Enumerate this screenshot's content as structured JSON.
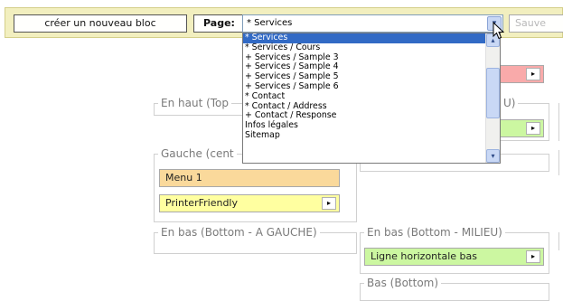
{
  "toolbar": {
    "new_block_label": "créer un nouveau bloc",
    "page_label": "Page:",
    "page_select_value": "* Services",
    "save_label": "Sauve"
  },
  "dropdown": {
    "items": [
      "* Services",
      "* Services / Cours",
      "+ Services / Sample 3",
      "+ Services / Sample 4",
      "+ Services / Sample 5",
      "+ Services / Sample 6",
      "* Contact",
      "* Contact / Address",
      "+ Contact / Response",
      "Infos légales",
      "Sitemap"
    ],
    "selected_index": 0
  },
  "zones": {
    "top_left_legend": "En haut (Top",
    "top_right_legend": "U)",
    "left_center_legend": "Gauche (cent",
    "bottom_left_legend": "En bas (Bottom - A GAUCHE)",
    "bottom_middle_legend": "En bas (Bottom - MILIEU)",
    "bottom_legend": "Bas (Bottom)"
  },
  "blocks": {
    "menu1": "Menu 1",
    "printer_friendly": "PrinterFriendly",
    "ligne_horizontale": "Ligne horizontale bas"
  },
  "icons": {
    "block_menu_arrow": "▸",
    "select_arrow": "▾",
    "scroll_up": "▴",
    "scroll_down": "▾"
  },
  "colors": {
    "toolbar_bg": "#f2efbf",
    "selected_item": "#316ac5",
    "block_orange": "#fad99b",
    "block_yellow": "#ffffa0",
    "block_green": "#ccf7a1",
    "block_pink": "#f9aaaa"
  }
}
